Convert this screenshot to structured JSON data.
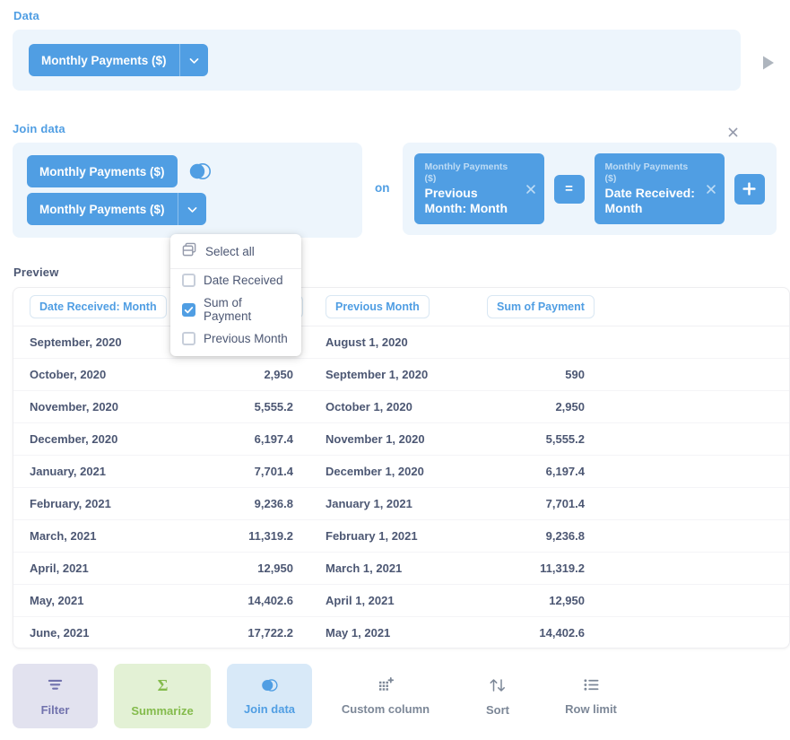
{
  "data_step": {
    "label": "Data",
    "source": "Monthly Payments ($)",
    "caret_icon": "chevron-down-icon",
    "run_icon": "play-icon"
  },
  "join_step": {
    "label": "Join data",
    "close_icon": "close-icon",
    "left_table": "Monthly Payments ($)",
    "right_table": "Monthly Payments ($)",
    "join_type_icon": "venn-left-join-icon",
    "on_word": "on",
    "operator": "=",
    "add_icon": "plus-icon",
    "remove_icon": "close-icon",
    "left_condition": {
      "table": "Monthly Payments ($)",
      "field": "Previous Month: Month"
    },
    "right_condition": {
      "table": "Monthly Payments ($)",
      "field": "Date Received: Month"
    }
  },
  "column_picker": {
    "select_all_label": "Select all",
    "select_all_icon": "stacked-table-icon",
    "items": [
      {
        "label": "Date Received",
        "checked": false
      },
      {
        "label": "Sum of Payment",
        "checked": true
      },
      {
        "label": "Previous Month",
        "checked": false
      }
    ]
  },
  "preview": {
    "label": "Preview",
    "columns": [
      "Date Received: Month",
      "Sum of Payment",
      "Previous Month",
      "Sum of Payment"
    ],
    "rows": [
      [
        "September, 2020",
        "",
        "August 1, 2020",
        ""
      ],
      [
        "October, 2020",
        "2,950",
        "September 1, 2020",
        "590"
      ],
      [
        "November, 2020",
        "5,555.2",
        "October 1, 2020",
        "2,950"
      ],
      [
        "December, 2020",
        "6,197.4",
        "November 1, 2020",
        "5,555.2"
      ],
      [
        "January, 2021",
        "7,701.4",
        "December 1, 2020",
        "6,197.4"
      ],
      [
        "February, 2021",
        "9,236.8",
        "January 1, 2021",
        "7,701.4"
      ],
      [
        "March, 2021",
        "11,319.2",
        "February 1, 2021",
        "9,236.8"
      ],
      [
        "April, 2021",
        "12,950",
        "March 1, 2021",
        "11,319.2"
      ],
      [
        "May, 2021",
        "14,402.6",
        "April 1, 2021",
        "12,950"
      ],
      [
        "June, 2021",
        "17,722.2",
        "May 1, 2021",
        "14,402.6"
      ]
    ]
  },
  "action_bar": {
    "buttons": [
      {
        "label": "Filter",
        "icon": "filter-icon",
        "active": true
      },
      {
        "label": "Summarize",
        "icon": "sigma-icon",
        "active": true
      },
      {
        "label": "Join data",
        "icon": "venn-icon",
        "active": true
      },
      {
        "label": "Custom column",
        "icon": "add-column-icon",
        "active": false
      },
      {
        "label": "Sort",
        "icon": "sort-arrows-icon",
        "active": false
      },
      {
        "label": "Row limit",
        "icon": "list-icon",
        "active": false
      }
    ]
  },
  "colors": {
    "brand_blue": "#509EE3",
    "panel_blue": "#EDF5FC",
    "text_dark": "#4C5773",
    "filter_purple": "#7172AD",
    "summarize_green": "#84BB4C",
    "muted_grey": "#7C8797"
  }
}
